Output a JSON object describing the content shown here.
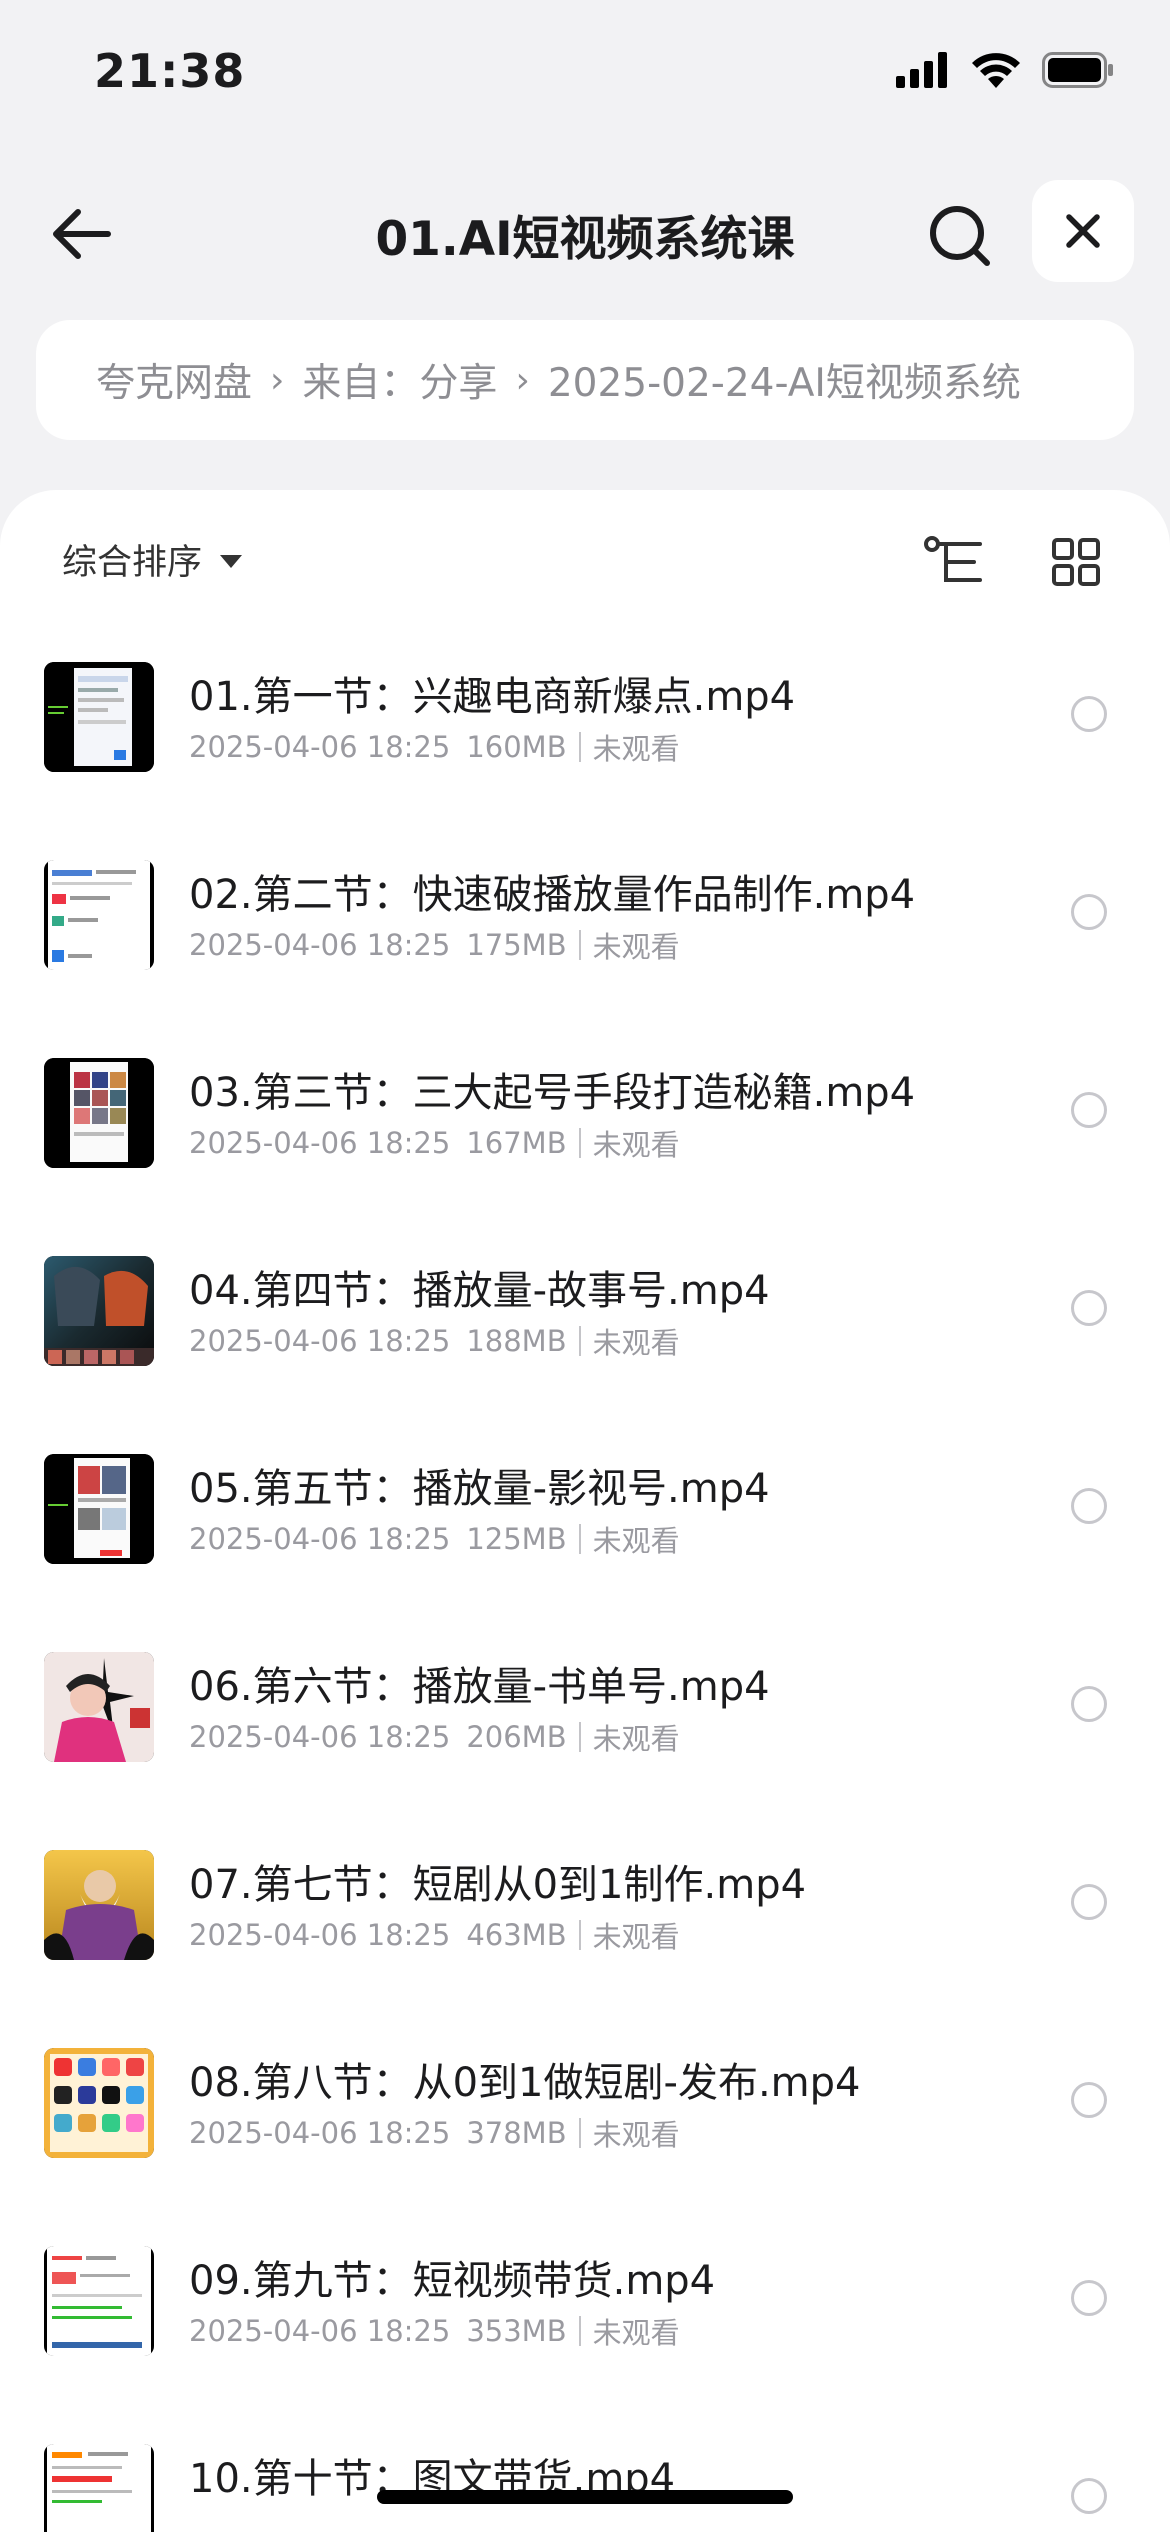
{
  "status_bar": {
    "time": "21:38"
  },
  "header": {
    "title": "01.AI短视频系统课"
  },
  "breadcrumb": {
    "items": [
      "夸克网盘",
      "来自：分享",
      "2025-02-24-AI短视频系统"
    ]
  },
  "toolbar": {
    "sort_label": "综合排序"
  },
  "files": [
    {
      "name": "01.第一节：兴趣电商新爆点.mp4",
      "date": "2025-04-06 18:25",
      "size": "160MB",
      "status": "未观看",
      "thumb": "phone-ui"
    },
    {
      "name": "02.第二节：快速破播放量作品制作.mp4",
      "date": "2025-04-06 18:25",
      "size": "175MB",
      "status": "未观看",
      "thumb": "doc-ui"
    },
    {
      "name": "03.第三节：三大起号手段打造秘籍.mp4",
      "date": "2025-04-06 18:25",
      "size": "167MB",
      "status": "未观看",
      "thumb": "phone-grid"
    },
    {
      "name": "04.第四节：播放量-故事号.mp4",
      "date": "2025-04-06 18:25",
      "size": "188MB",
      "status": "未观看",
      "thumb": "anime"
    },
    {
      "name": "05.第五节：播放量-影视号.mp4",
      "date": "2025-04-06 18:25",
      "size": "125MB",
      "status": "未观看",
      "thumb": "phone-red"
    },
    {
      "name": "06.第六节：播放量-书单号.mp4",
      "date": "2025-04-06 18:25",
      "size": "206MB",
      "status": "未观看",
      "thumb": "portrait-pink"
    },
    {
      "name": "07.第七节：短剧从0到1制作.mp4",
      "date": "2025-04-06 18:25",
      "size": "463MB",
      "status": "未观看",
      "thumb": "portrait-gold"
    },
    {
      "name": "08.第八节：从0到1做短剧-发布.mp4",
      "date": "2025-04-06 18:25",
      "size": "378MB",
      "status": "未观看",
      "thumb": "app-icons"
    },
    {
      "name": "09.第九节：短视频带货.mp4",
      "date": "2025-04-06 18:25",
      "size": "353MB",
      "status": "未观看",
      "thumb": "doc-ui-2"
    },
    {
      "name": "10.第十节：图文带货.mp4",
      "date": "",
      "size": "",
      "status": "",
      "thumb": "doc-ui-3"
    }
  ]
}
